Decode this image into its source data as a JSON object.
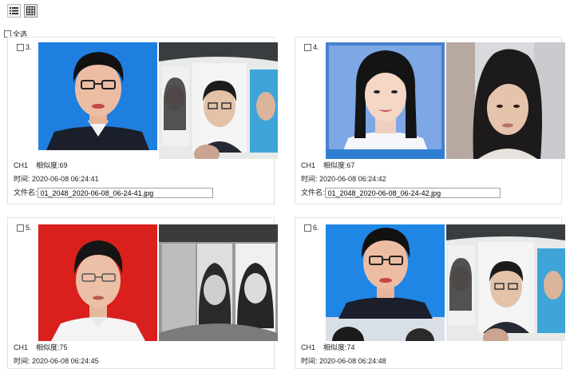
{
  "toolbar": {
    "list_view_icon": "list-icon",
    "grid_view_icon": "grid-icon"
  },
  "select_all_label": "全选",
  "colors": {
    "border": "#e2e2e2",
    "blue_bg": "#1f7fe0",
    "red_bg": "#d9201c"
  },
  "cards": [
    {
      "index": "3.",
      "channel": "CH1",
      "similarity_label": "相似度:",
      "similarity": "69",
      "time_label": "时间:",
      "time": "2020-06-08 06:24:41",
      "filename_label": "文件名:",
      "filename": "01_2048_2020-06-08_06-24-41.jpg"
    },
    {
      "index": "4.",
      "channel": "CH1",
      "similarity_label": "相似度:",
      "similarity": "67",
      "time_label": "时间:",
      "time": "2020-06-08 06:24:42",
      "filename_label": "文件名:",
      "filename": "01_2048_2020-06-08_06-24-42.jpg"
    },
    {
      "index": "5.",
      "channel": "CH1",
      "similarity_label": "相似度:",
      "similarity": "75",
      "time_label": "时间:",
      "time": "2020-06-08 06:24:45"
    },
    {
      "index": "6.",
      "channel": "CH1",
      "similarity_label": "相似度:",
      "similarity": "74",
      "time_label": "时间:",
      "time": "2020-06-08 06:24:48"
    }
  ]
}
